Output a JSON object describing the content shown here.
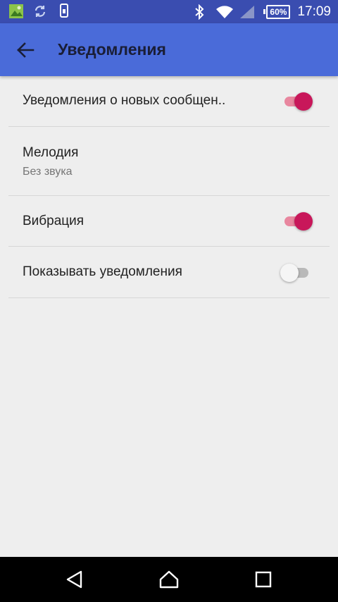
{
  "status_bar": {
    "battery_text": "60%",
    "time": "17:09",
    "icons": [
      "image-icon",
      "sync-icon",
      "phone-transfer-icon",
      "bluetooth-icon",
      "wifi-icon",
      "signal-icon",
      "battery-icon"
    ]
  },
  "app_bar": {
    "title": "Уведомления",
    "back_icon": "arrow-left-icon",
    "color": "#4a6bd9"
  },
  "settings": {
    "items": [
      {
        "title": "Уведомления о новых сообщен..",
        "control": "switch",
        "checked": true
      },
      {
        "title": "Мелодия",
        "summary": "Без звука"
      },
      {
        "title": "Вибрация",
        "control": "switch",
        "checked": true
      },
      {
        "title": "Показывать уведомления",
        "control": "switch",
        "checked": false
      }
    ],
    "accent_color": "#c8175a"
  },
  "nav_bar": {
    "buttons": [
      "back-triangle-icon",
      "home-icon",
      "recents-square-icon"
    ]
  }
}
